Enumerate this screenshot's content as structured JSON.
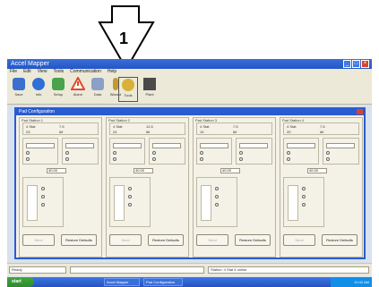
{
  "callout": {
    "number": "1"
  },
  "app": {
    "title": "Accel Mapper",
    "menu": [
      "File",
      "Edit",
      "View",
      "Tools",
      "Communication",
      "Help"
    ],
    "toolbar": [
      {
        "icon": "disk-icon",
        "color": "#3a6fd0",
        "label": "Save"
      },
      {
        "icon": "info-icon",
        "color": "#2f6fd6",
        "label": "Info"
      },
      {
        "icon": "leaf-icon",
        "color": "#4aa24a",
        "label": "Setup"
      },
      {
        "icon": "warning-icon",
        "color": "#e04a2a",
        "label": "Alarm"
      },
      {
        "icon": "chart-icon",
        "color": "#8aa0c8",
        "label": "Data"
      },
      {
        "icon": "wand-icon",
        "color": "#c39a2c",
        "label": "Wizard"
      },
      {
        "icon": "gear-icon",
        "color": "#d8b13a",
        "label": "Tools"
      },
      {
        "icon": "factory-icon",
        "color": "#4a4a4a",
        "label": "Plant"
      }
    ]
  },
  "dialog": {
    "title": "Pad Configuration",
    "panels": [
      {
        "title": "Pad Station 1",
        "switch_type": "4 Stat",
        "value1": "7.5",
        "capacity": "23",
        "unit": "lbf",
        "threshold": "40.00",
        "btn_left": "Send",
        "btn_right": "Restore Defaults"
      },
      {
        "title": "Pad Station 2",
        "switch_type": "4 Stat",
        "value1": "12.5",
        "capacity": "24",
        "unit": "lbf",
        "threshold": "40.00",
        "btn_left": "Send",
        "btn_right": "Restore Defaults"
      },
      {
        "title": "Pad Station 3",
        "switch_type": "4 Stat",
        "value1": "7.5",
        "capacity": "19",
        "unit": "lbf",
        "threshold": "40.00",
        "btn_left": "Send",
        "btn_right": "Restore Defaults"
      },
      {
        "title": "Pad Station 4",
        "switch_type": "4 Stat",
        "value1": "7.5",
        "capacity": "20",
        "unit": "lbf",
        "threshold": "40.00",
        "btn_left": "Send",
        "btn_right": "Restore Defaults"
      }
    ]
  },
  "status": {
    "left": "Ready",
    "middle": "",
    "right": "Station: 4 Stat 4 online"
  },
  "taskbar": {
    "start": "start",
    "tasks": [
      "Accel Mapper",
      "Pad Configuration"
    ],
    "clock": "10:42 AM"
  }
}
